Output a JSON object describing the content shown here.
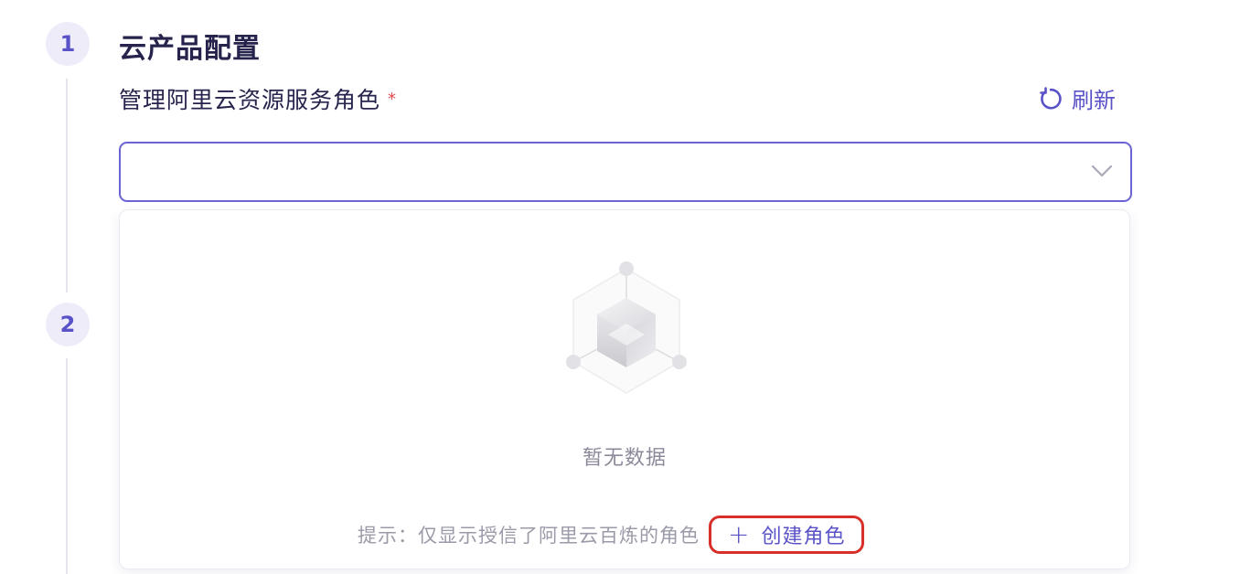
{
  "steps": [
    {
      "number": "1",
      "title": "云产品配置"
    },
    {
      "number": "2"
    }
  ],
  "field": {
    "label": "管理阿里云资源服务角色",
    "required_mark": "*",
    "refresh_label": "刷新",
    "select_value": ""
  },
  "dropdown": {
    "empty_text": "暂无数据",
    "hint_text": "提示：仅显示授信了阿里云百炼的角色",
    "create_label": "创建角色"
  },
  "icons": {
    "refresh": "refresh-icon",
    "select_arrow": "chevron-down-icon",
    "empty": "empty-box-icon",
    "create": "plus-icon"
  },
  "colors": {
    "accent": "#5a53c8",
    "highlight_border": "#d7302b",
    "required": "#e5484d"
  }
}
